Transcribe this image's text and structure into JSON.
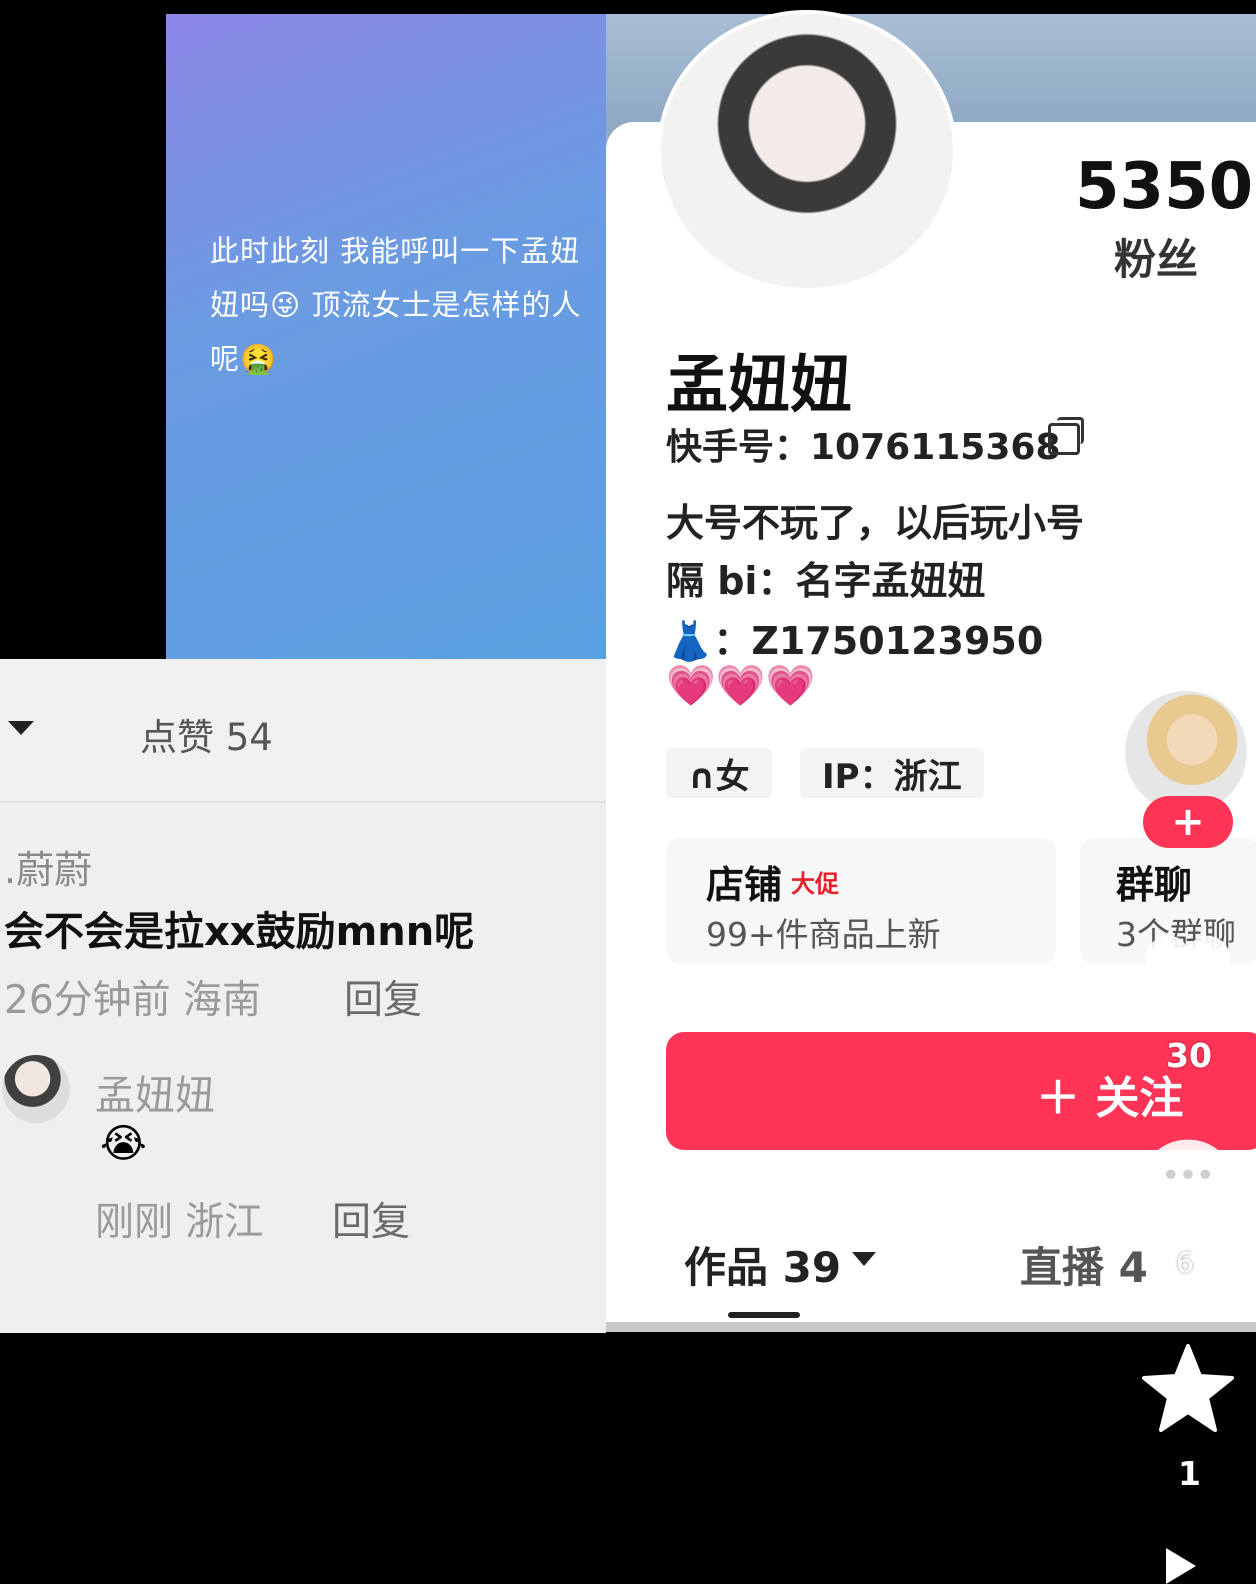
{
  "post": {
    "text": "此时此刻 我能呼叫一下孟妞\n妞吗😜 顶流女士是怎样的人\n呢🤮"
  },
  "comments": {
    "likes_label": "点赞 54",
    "comment": {
      "user": ".蔚蔚",
      "text": "会不会是拉xx鼓励mnn呢",
      "meta": "26分钟前 海南",
      "reply_label": "回复"
    },
    "reply": {
      "user": "孟妞妞",
      "emoji": "😭",
      "meta": "刚刚 浙江",
      "reply_label": "回复"
    }
  },
  "profile": {
    "fans_count": "5350",
    "fans_label": "粉丝",
    "name": "孟妞妞",
    "kuaishou_id": "快手号：1076115368",
    "bio": [
      "大号不玩了，以后玩小号",
      "隔 bi：名字孟妞妞",
      "👗：Z1750123950",
      "💗💗💗"
    ],
    "tags": {
      "gender": "∩女",
      "ip": "IP：浙江"
    },
    "store": {
      "title": "店铺",
      "badge": "大促",
      "subtitle": "99+件商品上新"
    },
    "group": {
      "title": "群聊",
      "subtitle": "3个群聊"
    },
    "follow_label": "＋ 关注",
    "tabs": {
      "works": "作品 39",
      "live": "直播 4"
    }
  },
  "overlay": {
    "follow_plus": "+",
    "like_count": "30",
    "comment_count": "6",
    "star_count": "1"
  }
}
